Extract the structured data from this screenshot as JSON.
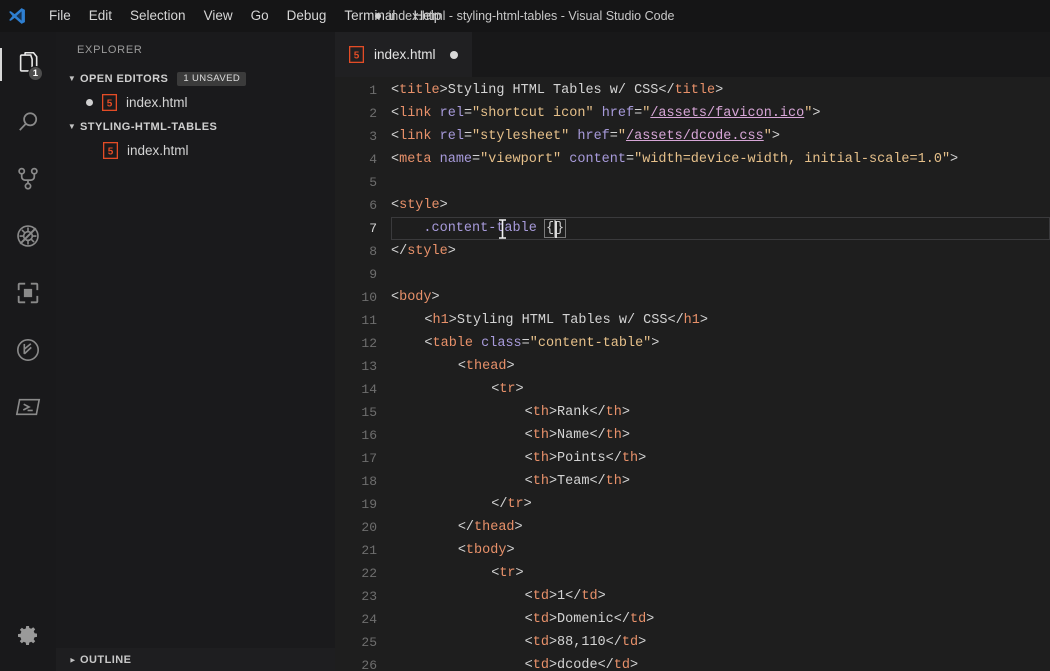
{
  "window": {
    "title": "index.html - styling-html-tables - Visual Studio Code",
    "dirty_indicator": "●"
  },
  "menu": {
    "items": [
      "File",
      "Edit",
      "Selection",
      "View",
      "Go",
      "Debug",
      "Terminal",
      "Help"
    ]
  },
  "activity_bar": {
    "items": [
      {
        "name": "explorer-icon",
        "badge": "1",
        "active": true
      },
      {
        "name": "search-icon",
        "badge": "",
        "active": false
      },
      {
        "name": "source-control-icon",
        "badge": "",
        "active": false
      },
      {
        "name": "run-and-debug-icon",
        "badge": "",
        "active": false
      },
      {
        "name": "extensions-icon",
        "badge": "",
        "active": false
      },
      {
        "name": "clock-branch-icon",
        "badge": "",
        "active": false
      },
      {
        "name": "powershell-terminal-icon",
        "badge": "",
        "active": false
      }
    ],
    "settings_icon": "gear-icon"
  },
  "sidebar": {
    "title": "EXPLORER",
    "open_editors": {
      "label": "OPEN EDITORS",
      "badge": "1 UNSAVED",
      "files": [
        {
          "name": "index.html",
          "dirty": true,
          "icon": "html5-icon"
        }
      ]
    },
    "project": {
      "label": "STYLING-HTML-TABLES",
      "files": [
        {
          "name": "index.html",
          "icon": "html5-icon"
        }
      ]
    },
    "outline": {
      "label": "OUTLINE"
    }
  },
  "editor": {
    "tabs": [
      {
        "label": "index.html",
        "icon": "html5-icon",
        "dirty": true,
        "active": true
      }
    ],
    "active_line": 7,
    "language": "html",
    "lines": [
      {
        "n": "1",
        "indent": 0,
        "tokens": [
          {
            "t": "<",
            "c": "t-punct"
          },
          {
            "t": "title",
            "c": "t-tag"
          },
          {
            "t": ">",
            "c": "t-punct"
          },
          {
            "t": "Styling HTML Tables w/ CSS",
            "c": "t-text"
          },
          {
            "t": "</",
            "c": "t-punct"
          },
          {
            "t": "title",
            "c": "t-tag"
          },
          {
            "t": ">",
            "c": "t-punct"
          }
        ]
      },
      {
        "n": "2",
        "indent": 0,
        "tokens": [
          {
            "t": "<",
            "c": "t-punct"
          },
          {
            "t": "link",
            "c": "t-tag"
          },
          {
            "t": " ",
            "c": "t-text"
          },
          {
            "t": "rel",
            "c": "t-attr"
          },
          {
            "t": "=",
            "c": "t-eq"
          },
          {
            "t": "\"shortcut icon\"",
            "c": "t-str"
          },
          {
            "t": " ",
            "c": "t-text"
          },
          {
            "t": "href",
            "c": "t-attr"
          },
          {
            "t": "=",
            "c": "t-eq"
          },
          {
            "t": "\"",
            "c": "t-str"
          },
          {
            "t": "/assets/favicon.ico",
            "c": "t-link"
          },
          {
            "t": "\"",
            "c": "t-str"
          },
          {
            "t": ">",
            "c": "t-punct"
          }
        ]
      },
      {
        "n": "3",
        "indent": 0,
        "tokens": [
          {
            "t": "<",
            "c": "t-punct"
          },
          {
            "t": "link",
            "c": "t-tag"
          },
          {
            "t": " ",
            "c": "t-text"
          },
          {
            "t": "rel",
            "c": "t-attr"
          },
          {
            "t": "=",
            "c": "t-eq"
          },
          {
            "t": "\"stylesheet\"",
            "c": "t-str"
          },
          {
            "t": " ",
            "c": "t-text"
          },
          {
            "t": "href",
            "c": "t-attr"
          },
          {
            "t": "=",
            "c": "t-eq"
          },
          {
            "t": "\"",
            "c": "t-str"
          },
          {
            "t": "/assets/dcode.css",
            "c": "t-link"
          },
          {
            "t": "\"",
            "c": "t-str"
          },
          {
            "t": ">",
            "c": "t-punct"
          }
        ]
      },
      {
        "n": "4",
        "indent": 0,
        "tokens": [
          {
            "t": "<",
            "c": "t-punct"
          },
          {
            "t": "meta",
            "c": "t-tag"
          },
          {
            "t": " ",
            "c": "t-text"
          },
          {
            "t": "name",
            "c": "t-attr"
          },
          {
            "t": "=",
            "c": "t-eq"
          },
          {
            "t": "\"viewport\"",
            "c": "t-str"
          },
          {
            "t": " ",
            "c": "t-text"
          },
          {
            "t": "content",
            "c": "t-attr"
          },
          {
            "t": "=",
            "c": "t-eq"
          },
          {
            "t": "\"width=device-width, initial-scale=1.0\"",
            "c": "t-str"
          },
          {
            "t": ">",
            "c": "t-punct"
          }
        ]
      },
      {
        "n": "5",
        "indent": 0,
        "tokens": []
      },
      {
        "n": "6",
        "indent": 0,
        "tokens": [
          {
            "t": "<",
            "c": "t-punct"
          },
          {
            "t": "style",
            "c": "t-tag"
          },
          {
            "t": ">",
            "c": "t-punct"
          }
        ]
      },
      {
        "n": "7",
        "indent": 0,
        "active": true,
        "tokens": [
          {
            "t": "    ",
            "c": "t-text"
          },
          {
            "t": ".content-table",
            "c": "t-sel"
          },
          {
            "t": " ",
            "c": "t-text"
          }
        ],
        "bracket_pair": "{}",
        "caret": true
      },
      {
        "n": "8",
        "indent": 0,
        "tokens": [
          {
            "t": "</",
            "c": "t-punct"
          },
          {
            "t": "style",
            "c": "t-tag"
          },
          {
            "t": ">",
            "c": "t-punct"
          }
        ]
      },
      {
        "n": "9",
        "indent": 0,
        "tokens": []
      },
      {
        "n": "10",
        "indent": 0,
        "tokens": [
          {
            "t": "<",
            "c": "t-punct"
          },
          {
            "t": "body",
            "c": "t-tag"
          },
          {
            "t": ">",
            "c": "t-punct"
          }
        ]
      },
      {
        "n": "11",
        "indent": 1,
        "tokens": [
          {
            "t": "    ",
            "c": "t-text"
          },
          {
            "t": "<",
            "c": "t-punct"
          },
          {
            "t": "h1",
            "c": "t-tag"
          },
          {
            "t": ">",
            "c": "t-punct"
          },
          {
            "t": "Styling HTML Tables w/ CSS",
            "c": "t-text"
          },
          {
            "t": "</",
            "c": "t-punct"
          },
          {
            "t": "h1",
            "c": "t-tag"
          },
          {
            "t": ">",
            "c": "t-punct"
          }
        ]
      },
      {
        "n": "12",
        "indent": 1,
        "tokens": [
          {
            "t": "    ",
            "c": "t-text"
          },
          {
            "t": "<",
            "c": "t-punct"
          },
          {
            "t": "table",
            "c": "t-tag"
          },
          {
            "t": " ",
            "c": "t-text"
          },
          {
            "t": "class",
            "c": "t-attr"
          },
          {
            "t": "=",
            "c": "t-eq"
          },
          {
            "t": "\"content-table\"",
            "c": "t-str"
          },
          {
            "t": ">",
            "c": "t-punct"
          }
        ]
      },
      {
        "n": "13",
        "indent": 2,
        "tokens": [
          {
            "t": "        ",
            "c": "t-text"
          },
          {
            "t": "<",
            "c": "t-punct"
          },
          {
            "t": "thead",
            "c": "t-tag"
          },
          {
            "t": ">",
            "c": "t-punct"
          }
        ]
      },
      {
        "n": "14",
        "indent": 3,
        "tokens": [
          {
            "t": "            ",
            "c": "t-text"
          },
          {
            "t": "<",
            "c": "t-punct"
          },
          {
            "t": "tr",
            "c": "t-tag"
          },
          {
            "t": ">",
            "c": "t-punct"
          }
        ]
      },
      {
        "n": "15",
        "indent": 4,
        "tokens": [
          {
            "t": "                ",
            "c": "t-text"
          },
          {
            "t": "<",
            "c": "t-punct"
          },
          {
            "t": "th",
            "c": "t-tag"
          },
          {
            "t": ">",
            "c": "t-punct"
          },
          {
            "t": "Rank",
            "c": "t-text"
          },
          {
            "t": "</",
            "c": "t-punct"
          },
          {
            "t": "th",
            "c": "t-tag"
          },
          {
            "t": ">",
            "c": "t-punct"
          }
        ]
      },
      {
        "n": "16",
        "indent": 4,
        "tokens": [
          {
            "t": "                ",
            "c": "t-text"
          },
          {
            "t": "<",
            "c": "t-punct"
          },
          {
            "t": "th",
            "c": "t-tag"
          },
          {
            "t": ">",
            "c": "t-punct"
          },
          {
            "t": "Name",
            "c": "t-text"
          },
          {
            "t": "</",
            "c": "t-punct"
          },
          {
            "t": "th",
            "c": "t-tag"
          },
          {
            "t": ">",
            "c": "t-punct"
          }
        ]
      },
      {
        "n": "17",
        "indent": 4,
        "tokens": [
          {
            "t": "                ",
            "c": "t-text"
          },
          {
            "t": "<",
            "c": "t-punct"
          },
          {
            "t": "th",
            "c": "t-tag"
          },
          {
            "t": ">",
            "c": "t-punct"
          },
          {
            "t": "Points",
            "c": "t-text"
          },
          {
            "t": "</",
            "c": "t-punct"
          },
          {
            "t": "th",
            "c": "t-tag"
          },
          {
            "t": ">",
            "c": "t-punct"
          }
        ]
      },
      {
        "n": "18",
        "indent": 4,
        "tokens": [
          {
            "t": "                ",
            "c": "t-text"
          },
          {
            "t": "<",
            "c": "t-punct"
          },
          {
            "t": "th",
            "c": "t-tag"
          },
          {
            "t": ">",
            "c": "t-punct"
          },
          {
            "t": "Team",
            "c": "t-text"
          },
          {
            "t": "</",
            "c": "t-punct"
          },
          {
            "t": "th",
            "c": "t-tag"
          },
          {
            "t": ">",
            "c": "t-punct"
          }
        ]
      },
      {
        "n": "19",
        "indent": 3,
        "tokens": [
          {
            "t": "            ",
            "c": "t-text"
          },
          {
            "t": "</",
            "c": "t-punct"
          },
          {
            "t": "tr",
            "c": "t-tag"
          },
          {
            "t": ">",
            "c": "t-punct"
          }
        ]
      },
      {
        "n": "20",
        "indent": 2,
        "tokens": [
          {
            "t": "        ",
            "c": "t-text"
          },
          {
            "t": "</",
            "c": "t-punct"
          },
          {
            "t": "thead",
            "c": "t-tag"
          },
          {
            "t": ">",
            "c": "t-punct"
          }
        ]
      },
      {
        "n": "21",
        "indent": 2,
        "tokens": [
          {
            "t": "        ",
            "c": "t-text"
          },
          {
            "t": "<",
            "c": "t-punct"
          },
          {
            "t": "tbody",
            "c": "t-tag"
          },
          {
            "t": ">",
            "c": "t-punct"
          }
        ]
      },
      {
        "n": "22",
        "indent": 3,
        "tokens": [
          {
            "t": "            ",
            "c": "t-text"
          },
          {
            "t": "<",
            "c": "t-punct"
          },
          {
            "t": "tr",
            "c": "t-tag"
          },
          {
            "t": ">",
            "c": "t-punct"
          }
        ]
      },
      {
        "n": "23",
        "indent": 4,
        "tokens": [
          {
            "t": "                ",
            "c": "t-text"
          },
          {
            "t": "<",
            "c": "t-punct"
          },
          {
            "t": "td",
            "c": "t-tag"
          },
          {
            "t": ">",
            "c": "t-punct"
          },
          {
            "t": "1",
            "c": "t-text"
          },
          {
            "t": "</",
            "c": "t-punct"
          },
          {
            "t": "td",
            "c": "t-tag"
          },
          {
            "t": ">",
            "c": "t-punct"
          }
        ]
      },
      {
        "n": "24",
        "indent": 4,
        "tokens": [
          {
            "t": "                ",
            "c": "t-text"
          },
          {
            "t": "<",
            "c": "t-punct"
          },
          {
            "t": "td",
            "c": "t-tag"
          },
          {
            "t": ">",
            "c": "t-punct"
          },
          {
            "t": "Domenic",
            "c": "t-text"
          },
          {
            "t": "</",
            "c": "t-punct"
          },
          {
            "t": "td",
            "c": "t-tag"
          },
          {
            "t": ">",
            "c": "t-punct"
          }
        ]
      },
      {
        "n": "25",
        "indent": 4,
        "tokens": [
          {
            "t": "                ",
            "c": "t-text"
          },
          {
            "t": "<",
            "c": "t-punct"
          },
          {
            "t": "td",
            "c": "t-tag"
          },
          {
            "t": ">",
            "c": "t-punct"
          },
          {
            "t": "88,110",
            "c": "t-text"
          },
          {
            "t": "</",
            "c": "t-punct"
          },
          {
            "t": "td",
            "c": "t-tag"
          },
          {
            "t": ">",
            "c": "t-punct"
          }
        ]
      },
      {
        "n": "26",
        "indent": 4,
        "tokens": [
          {
            "t": "                ",
            "c": "t-text"
          },
          {
            "t": "<",
            "c": "t-punct"
          },
          {
            "t": "td",
            "c": "t-tag"
          },
          {
            "t": ">",
            "c": "t-punct"
          },
          {
            "t": "dcode",
            "c": "t-text"
          },
          {
            "t": "</",
            "c": "t-punct"
          },
          {
            "t": "td",
            "c": "t-tag"
          },
          {
            "t": ">",
            "c": "t-punct"
          }
        ]
      }
    ]
  },
  "colors": {
    "titlebar_bg": "#151516",
    "activitybar_bg": "#19191b",
    "sidebar_bg": "#1a1a1c",
    "editor_bg": "#1e1e1e",
    "tabbar_bg": "#181819",
    "tab_active_bg": "#202022",
    "html_icon": "#e34c26",
    "tag": "#e8916a",
    "attribute": "#a89bdb",
    "string": "#e6c08a",
    "link": "#d7a6d7",
    "text": "#d4d4d4"
  }
}
